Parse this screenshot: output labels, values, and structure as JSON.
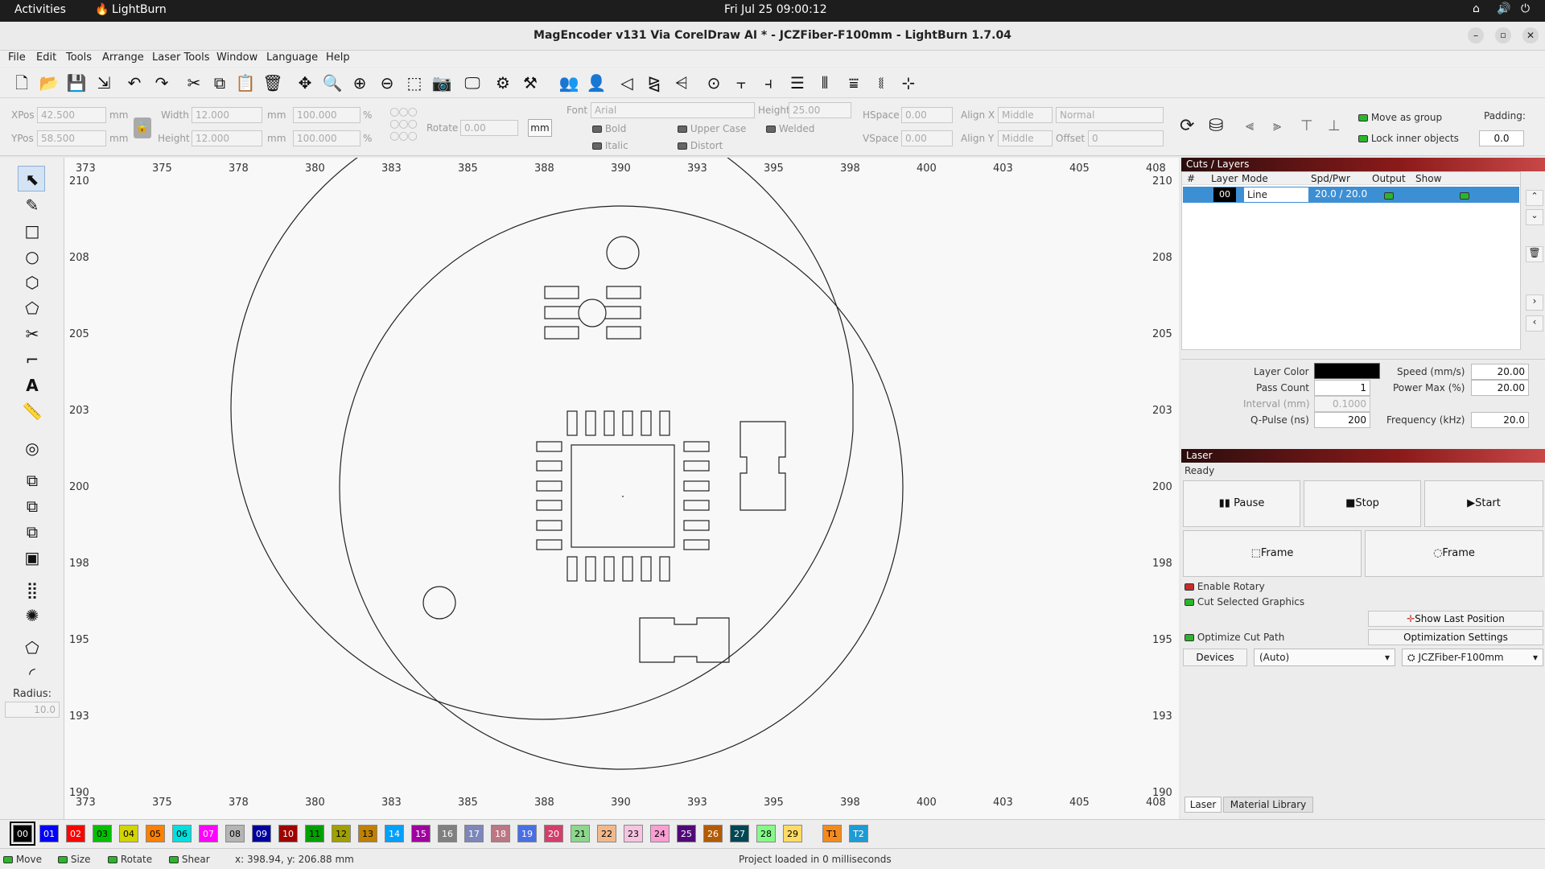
{
  "os": {
    "activities": "Activities",
    "app_name": "LightBurn",
    "clock": "Fri Jul 25  09:00:12"
  },
  "window": {
    "title": "MagEncoder v131 Via CorelDraw AI * - JCZFiber-F100mm - LightBurn 1.7.04"
  },
  "menu": [
    "File",
    "Edit",
    "Tools",
    "Arrange",
    "Laser Tools",
    "Window",
    "Language",
    "Help"
  ],
  "props": {
    "xpos_label": "XPos",
    "xpos": "42.500",
    "ypos_label": "YPos",
    "ypos": "58.500",
    "width_label": "Width",
    "width": "12.000",
    "height_label": "Height",
    "height": "12.000",
    "unit_mm": "mm",
    "scale_w": "100.000",
    "scale_h": "100.000",
    "pct": "%",
    "rotate_label": "Rotate",
    "rotate": "0.00",
    "unit_button": "mm",
    "font_label": "Font",
    "font": "Arial",
    "font_height_label": "Height",
    "font_height": "25.00",
    "hspace_label": "HSpace",
    "hspace": "0.00",
    "vspace_label": "VSpace",
    "vspace": "0.00",
    "alignx_label": "Align X",
    "alignx": "Middle",
    "aligny_label": "Align Y",
    "aligny": "Middle",
    "normal": "Normal",
    "offset_label": "Offset",
    "offset": "0",
    "bold": "Bold",
    "italic": "Italic",
    "upper": "Upper Case",
    "distort": "Distort",
    "welded": "Welded",
    "move_group": "Move as group",
    "lock_inner": "Lock inner objects",
    "padding_label": "Padding:",
    "padding": "0.0"
  },
  "left_tools": {
    "radius_label": "Radius:",
    "radius": "10.0"
  },
  "ruler": {
    "x": [
      "373",
      "375",
      "378",
      "380",
      "383",
      "385",
      "388",
      "390",
      "393",
      "395",
      "398",
      "400",
      "403",
      "405",
      "408"
    ],
    "y": [
      "210",
      "208",
      "205",
      "203",
      "200",
      "198",
      "195",
      "193",
      "190"
    ]
  },
  "cuts": {
    "title": "Cuts / Layers",
    "headers": [
      "#",
      "Layer",
      "Mode",
      "Spd/Pwr",
      "Output",
      "Show"
    ],
    "row": {
      "layer": "00",
      "mode": "Line",
      "spdpwr": "20.0 / 20.0"
    },
    "layer_color_label": "Layer Color",
    "layer_color": "#000000",
    "pass_count_label": "Pass Count",
    "pass_count": "1",
    "interval_label": "Interval (mm)",
    "interval": "0.1000",
    "qpulse_label": "Q-Pulse (ns)",
    "qpulse": "200",
    "speed_label": "Speed (mm/s)",
    "speed": "20.00",
    "power_label": "Power Max (%)",
    "power": "20.00",
    "freq_label": "Frequency (kHz)",
    "freq": "20.0"
  },
  "laser": {
    "title": "Laser",
    "status": "Ready",
    "pause": "Pause",
    "stop": "Stop",
    "start": "Start",
    "frame1": "Frame",
    "frame2": "Frame",
    "enable_rotary": "Enable Rotary",
    "cut_selected": "Cut Selected Graphics",
    "show_last": "Show Last Position",
    "optimize": "Optimize Cut Path",
    "opt_settings": "Optimization Settings",
    "devices": "Devices",
    "port": "(Auto)",
    "device": "JCZFiber-F100mm"
  },
  "bottom_tabs": [
    "Laser",
    "Material Library"
  ],
  "palette": [
    {
      "id": "00",
      "color": "#000000",
      "text": "#ffffff"
    },
    {
      "id": "01",
      "color": "#0000ff",
      "text": "#ffffff"
    },
    {
      "id": "02",
      "color": "#ff0000",
      "text": "#ffffff"
    },
    {
      "id": "03",
      "color": "#00c000",
      "text": "#000000"
    },
    {
      "id": "04",
      "color": "#d4d400",
      "text": "#000000"
    },
    {
      "id": "05",
      "color": "#ff8000",
      "text": "#000000"
    },
    {
      "id": "06",
      "color": "#00e0e0",
      "text": "#000000"
    },
    {
      "id": "07",
      "color": "#ff00ff",
      "text": "#ffffff"
    },
    {
      "id": "08",
      "color": "#b4b4b4",
      "text": "#000000"
    },
    {
      "id": "09",
      "color": "#0000a0",
      "text": "#ffffff"
    },
    {
      "id": "10",
      "color": "#a00000",
      "text": "#ffffff"
    },
    {
      "id": "11",
      "color": "#00a000",
      "text": "#000000"
    },
    {
      "id": "12",
      "color": "#a0a000",
      "text": "#000000"
    },
    {
      "id": "13",
      "color": "#c08000",
      "text": "#000000"
    },
    {
      "id": "14",
      "color": "#00a0ff",
      "text": "#ffffff"
    },
    {
      "id": "15",
      "color": "#a000a0",
      "text": "#ffffff"
    },
    {
      "id": "16",
      "color": "#808080",
      "text": "#ffffff"
    },
    {
      "id": "17",
      "color": "#7d87b9",
      "text": "#ffffff"
    },
    {
      "id": "18",
      "color": "#bb7784",
      "text": "#ffffff"
    },
    {
      "id": "19",
      "color": "#4a6fe3",
      "text": "#ffffff"
    },
    {
      "id": "20",
      "color": "#d33f6a",
      "text": "#ffffff"
    },
    {
      "id": "21",
      "color": "#8cd78c",
      "text": "#000000"
    },
    {
      "id": "22",
      "color": "#f0b98d",
      "text": "#000000"
    },
    {
      "id": "23",
      "color": "#f6c4e1",
      "text": "#000000"
    },
    {
      "id": "24",
      "color": "#fa9ed4",
      "text": "#000000"
    },
    {
      "id": "25",
      "color": "#500a78",
      "text": "#ffffff"
    },
    {
      "id": "26",
      "color": "#b45a00",
      "text": "#ffffff"
    },
    {
      "id": "27",
      "color": "#004754",
      "text": "#ffffff"
    },
    {
      "id": "28",
      "color": "#86fa88",
      "text": "#000000"
    },
    {
      "id": "29",
      "color": "#ffdb66",
      "text": "#000000"
    },
    {
      "id": "T1",
      "color": "#f38a1e",
      "text": "#000000"
    },
    {
      "id": "T2",
      "color": "#1e9bd4",
      "text": "#ffffff"
    }
  ],
  "status": {
    "move": "Move",
    "size": "Size",
    "rotate": "Rotate",
    "shear": "Shear",
    "coords": "x: 398.94, y: 206.88 mm",
    "message": "Project loaded in 0 milliseconds"
  }
}
